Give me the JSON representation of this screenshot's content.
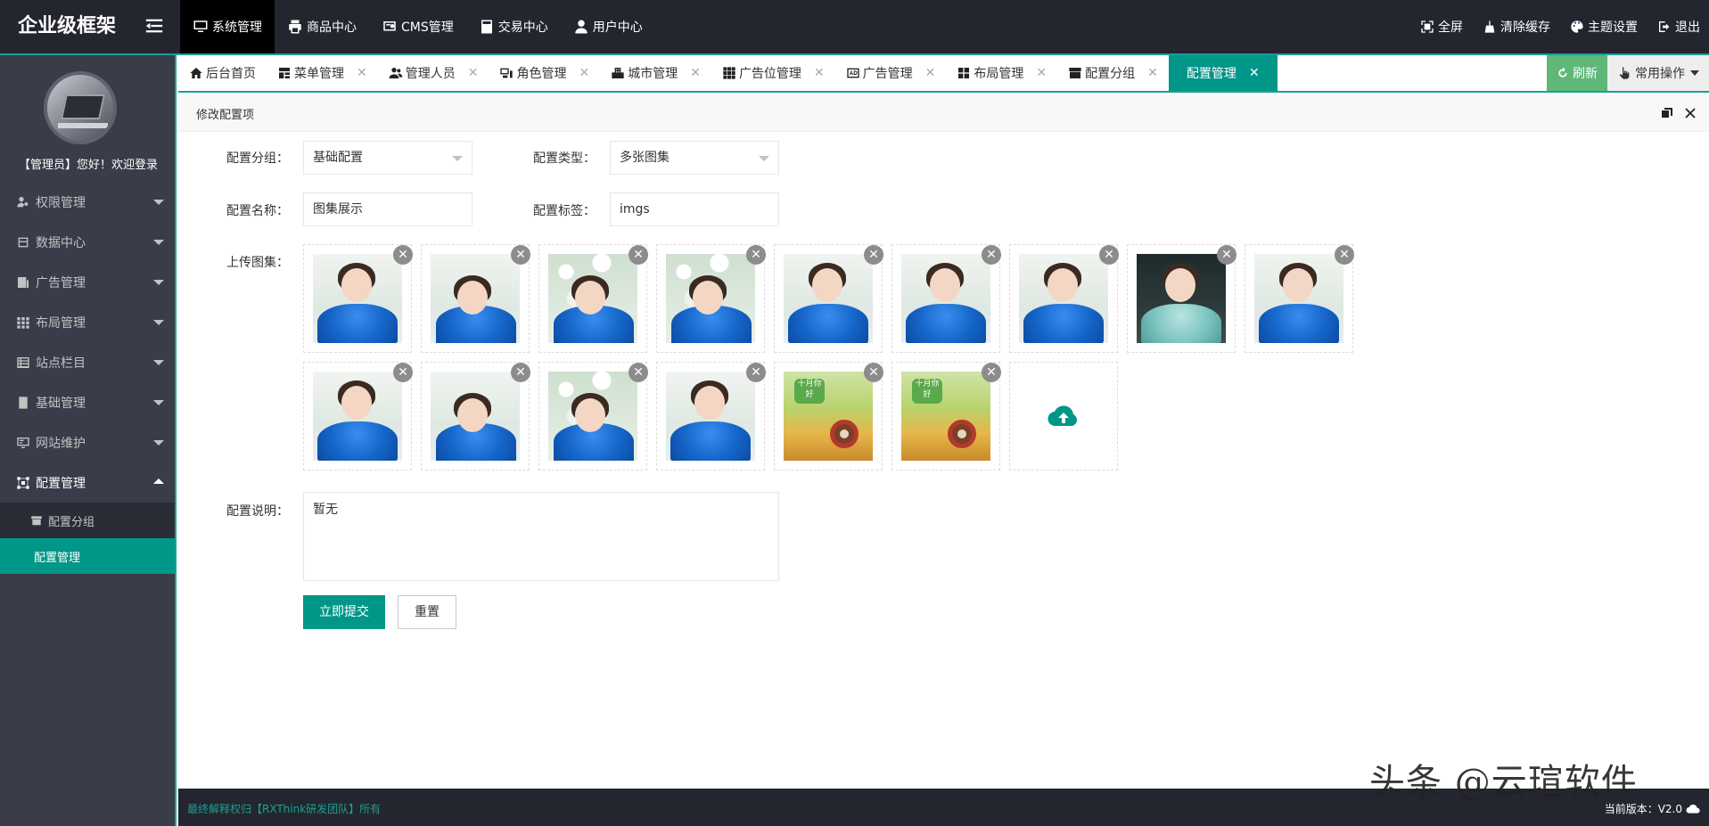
{
  "header": {
    "logo": "企业级框架",
    "nav": [
      {
        "label": "系统管理",
        "icon": "monitor-icon",
        "active": true
      },
      {
        "label": "商品中心",
        "icon": "printer-icon"
      },
      {
        "label": "CMS管理",
        "icon": "cms-icon"
      },
      {
        "label": "交易中心",
        "icon": "calculator-icon"
      },
      {
        "label": "用户中心",
        "icon": "user-icon"
      }
    ],
    "right": [
      {
        "label": "全屏",
        "icon": "fullscreen-icon"
      },
      {
        "label": "清除缓存",
        "icon": "broom-icon"
      },
      {
        "label": "主题设置",
        "icon": "palette-icon"
      },
      {
        "label": "退出",
        "icon": "logout-icon"
      }
    ]
  },
  "sidebar": {
    "welcome": "【管理员】您好！欢迎登录",
    "items": [
      {
        "label": "权限管理",
        "icon": "user-key-icon"
      },
      {
        "label": "数据中心",
        "icon": "database-icon"
      },
      {
        "label": "广告管理",
        "icon": "ad-icon"
      },
      {
        "label": "布局管理",
        "icon": "grid-icon"
      },
      {
        "label": "站点栏目",
        "icon": "list-icon"
      },
      {
        "label": "基础管理",
        "icon": "document-icon"
      },
      {
        "label": "网站维护",
        "icon": "monitor-settings-icon"
      },
      {
        "label": "配置管理",
        "icon": "config-icon",
        "open": true
      }
    ],
    "subitems": [
      {
        "label": "配置分组",
        "icon": "group-icon"
      },
      {
        "label": "配置管理",
        "active": true
      }
    ]
  },
  "tabs": [
    {
      "label": "后台首页",
      "icon": "home-icon",
      "closable": false
    },
    {
      "label": "菜单管理",
      "icon": "menu-icon",
      "closable": true
    },
    {
      "label": "管理人员",
      "icon": "users-icon",
      "closable": true
    },
    {
      "label": "角色管理",
      "icon": "role-icon",
      "closable": true
    },
    {
      "label": "城市管理",
      "icon": "city-icon",
      "closable": true
    },
    {
      "label": "广告位管理",
      "icon": "grid-icon",
      "closable": true
    },
    {
      "label": "广告管理",
      "icon": "ad-icon",
      "closable": true
    },
    {
      "label": "布局管理",
      "icon": "layout-icon",
      "closable": true
    },
    {
      "label": "配置分组",
      "icon": "group-icon",
      "closable": true
    },
    {
      "label": "配置管理",
      "active": true,
      "closable": true
    }
  ],
  "tabbar": {
    "refresh": "刷新",
    "common_ops": "常用操作"
  },
  "panel": {
    "title": "修改配置项"
  },
  "form": {
    "group_label": "配置分组：",
    "group_value": "基础配置",
    "type_label": "配置类型：",
    "type_value": "多张图集",
    "name_label": "配置名称：",
    "name_value": "图集展示",
    "tag_label": "配置标签：",
    "tag_value": "imgs",
    "gallery_label": "上传图集：",
    "desc_label": "配置说明：",
    "desc_value": "暂无",
    "submit": "立即提交",
    "reset": "重置"
  },
  "gallery": [
    {
      "kind": "girl-white"
    },
    {
      "kind": "girl-lying"
    },
    {
      "kind": "girl-flower"
    },
    {
      "kind": "girl-flower"
    },
    {
      "kind": "girl-white"
    },
    {
      "kind": "girl-white"
    },
    {
      "kind": "girl-white"
    },
    {
      "kind": "girl-teal"
    },
    {
      "kind": "girl-white"
    },
    {
      "kind": "girl-white"
    },
    {
      "kind": "girl-lying"
    },
    {
      "kind": "girl-flower"
    },
    {
      "kind": "girl-white"
    },
    {
      "kind": "cartoon"
    },
    {
      "kind": "cartoon"
    }
  ],
  "cartoon_sign_text": "十月你好",
  "footer": {
    "left": "最终解释权归【RXThink研发团队】所有",
    "right": "当前版本：V2.0"
  },
  "watermark": "头条 @云瑄软件"
}
